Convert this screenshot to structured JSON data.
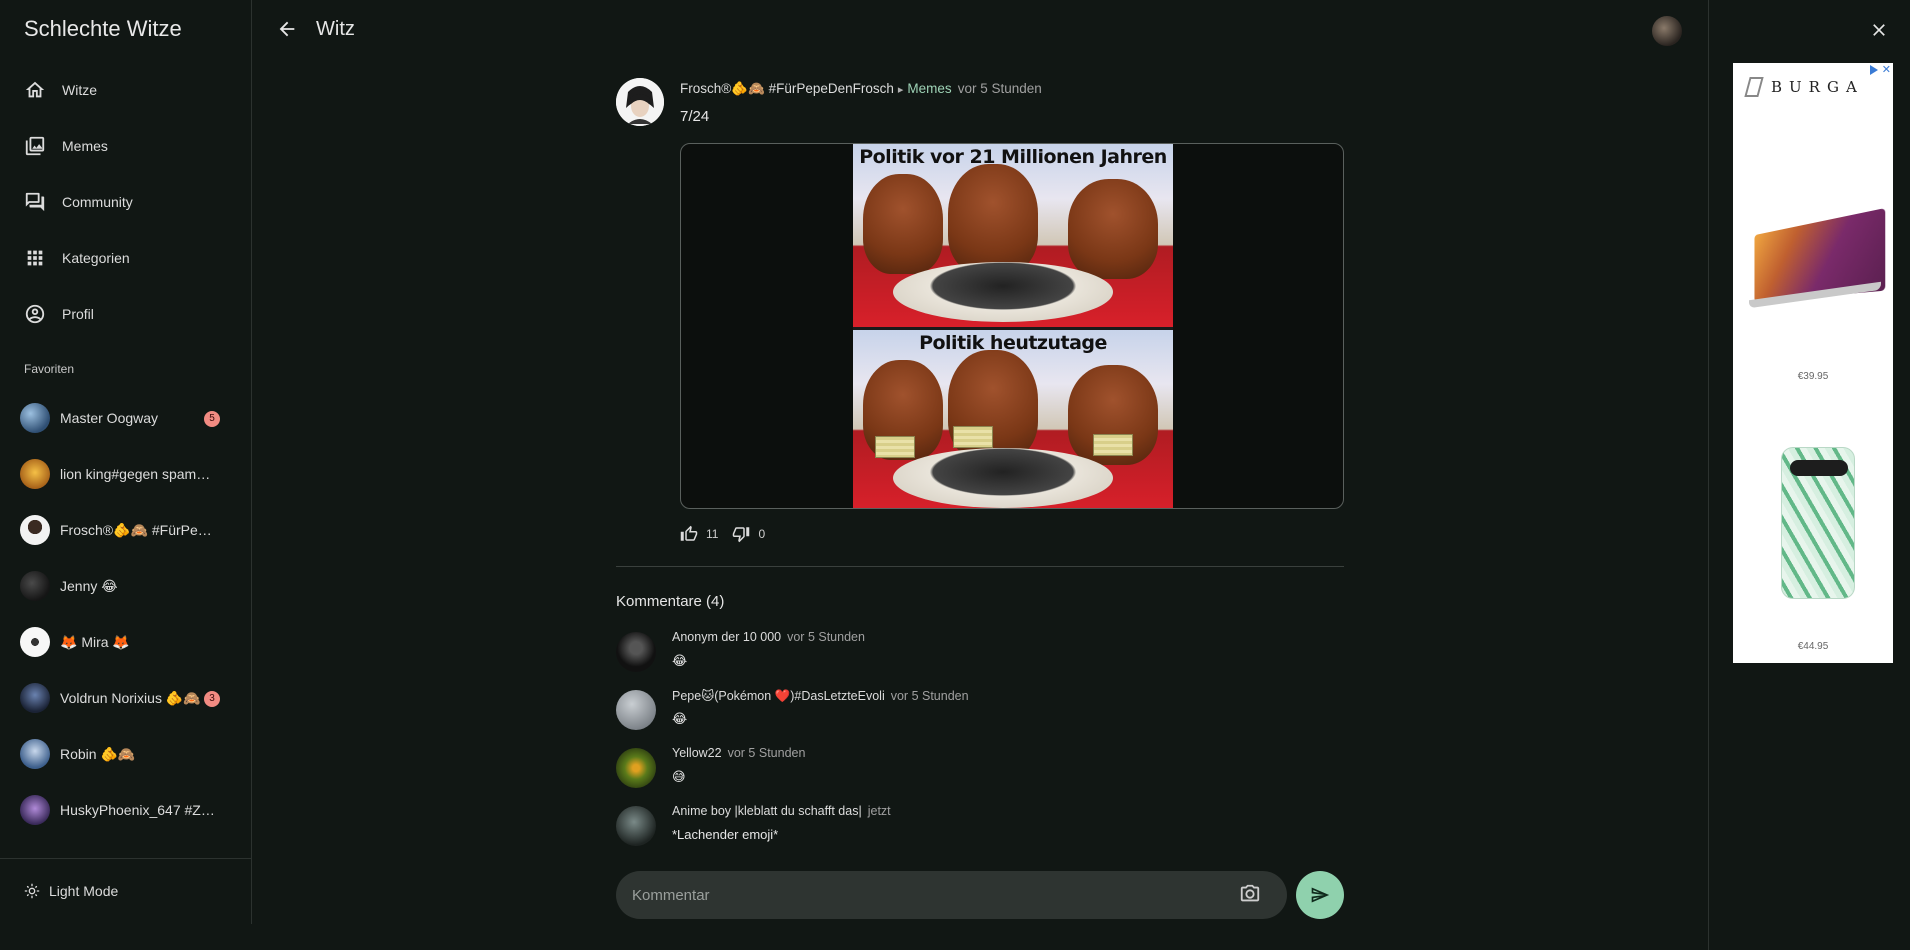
{
  "app": {
    "title": "Schlechte Witze"
  },
  "nav": [
    {
      "label": "Witze",
      "icon": "home-icon"
    },
    {
      "label": "Memes",
      "icon": "image-icon"
    },
    {
      "label": "Community",
      "icon": "forum-icon"
    },
    {
      "label": "Kategorien",
      "icon": "grid-icon"
    },
    {
      "label": "Profil",
      "icon": "account-circle-icon"
    }
  ],
  "favorites": {
    "header": "Favoriten",
    "items": [
      {
        "name": "Master Oogway",
        "badge": "5",
        "avatar_color": "#4a6b8a"
      },
      {
        "name": "lion king#gegen spam…",
        "badge": "",
        "avatar_color": "#c98a2a"
      },
      {
        "name": "Frosch®🫵🙈 #FürPep…",
        "badge": "",
        "avatar_color": "#f2f2f2"
      },
      {
        "name": "Jenny 😂",
        "badge": "",
        "avatar_color": "#2a2a2a"
      },
      {
        "name": "🦊 Mira 🦊",
        "badge": "",
        "avatar_color": "#f5f5f5"
      },
      {
        "name": "Voldrun Norixius 🫵🙈",
        "badge": "3",
        "avatar_color": "#2e3a55"
      },
      {
        "name": "Robin 🫵🙈",
        "badge": "",
        "avatar_color": "#5a7fa8"
      },
      {
        "name": "HuskyPhoenix_647 #Z…",
        "badge": "",
        "avatar_color": "#5a4a7a"
      }
    ]
  },
  "sidebar_footer": {
    "light_mode_label": "Light Mode"
  },
  "header": {
    "title": "Witz"
  },
  "post": {
    "author": "Frosch®🫵🙈 #FürPepeDenFrosch",
    "category": "Memes",
    "time": "vor 5 Stunden",
    "text": "7/24",
    "meme_caption_top": "Politik vor 21 Millionen Jahren",
    "meme_caption_bottom": "Politik heutzutage",
    "likes": "11",
    "dislikes": "0"
  },
  "comments": {
    "title": "Kommentare (4)",
    "items": [
      {
        "author": "Anonym der 10 000",
        "time": "vor 5 Stunden",
        "text": "😂",
        "avatar_color": "#1a1a1a"
      },
      {
        "author": "Pepe🐱(Pokémon ❤️)#DasLetzteEvoli",
        "time": "vor 5 Stunden",
        "text": "😂",
        "avatar_color": "#9aa0a4"
      },
      {
        "author": "Yellow22",
        "time": "vor 5 Stunden",
        "text": "😅",
        "avatar_color": "#6b7a2a"
      },
      {
        "author": "Anime boy |kleblatt du schafft das|",
        "time": "jetzt",
        "text": "*Lachender emoji*",
        "avatar_color": "#3a3f3c"
      }
    ]
  },
  "composer": {
    "placeholder": "Kommentar"
  },
  "ad": {
    "brand": "BURGA",
    "price_1": "€39.95",
    "price_2": "€44.95",
    "close_symbol": "✕"
  }
}
